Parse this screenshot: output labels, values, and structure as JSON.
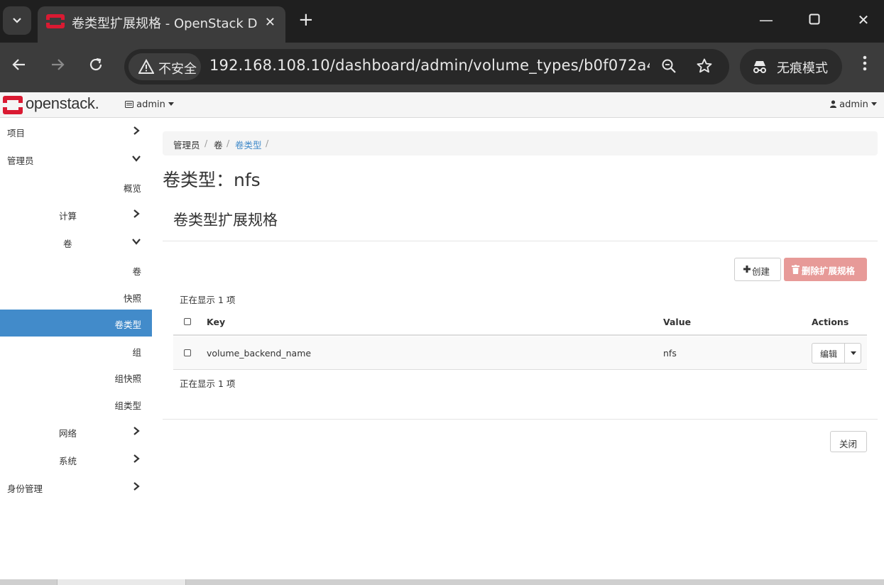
{
  "browser": {
    "tab_title": "卷类型扩展规格 - OpenStack D",
    "security_label": "不安全",
    "url": "192.168.108.10/dashboard/admin/volume_types/b0f072a4-...",
    "incognito_label": "无痕模式"
  },
  "navbar": {
    "logo_text": "openstack.",
    "project_label": "admin",
    "user_label": "admin"
  },
  "sidebar": {
    "items": [
      {
        "label": "项目"
      },
      {
        "label": "管理员"
      },
      {
        "label": "概览"
      },
      {
        "label": "计算"
      },
      {
        "label": "卷"
      },
      {
        "label": "卷"
      },
      {
        "label": "快照"
      },
      {
        "label": "卷类型"
      },
      {
        "label": "组"
      },
      {
        "label": "组快照"
      },
      {
        "label": "组类型"
      },
      {
        "label": "网络"
      },
      {
        "label": "系统"
      },
      {
        "label": "身份管理"
      }
    ]
  },
  "breadcrumb": {
    "items": [
      "管理员",
      "卷",
      "卷类型"
    ],
    "separator": "/"
  },
  "page": {
    "title": "卷类型：nfs",
    "section_title": "卷类型扩展规格",
    "create_label": "创建",
    "delete_label": "删除扩展规格",
    "count_top": "正在显示 1 项",
    "count_bottom": "正在显示 1 项",
    "close_label": "关闭"
  },
  "table": {
    "headers": {
      "key": "Key",
      "value": "Value",
      "actions": "Actions"
    },
    "rows": [
      {
        "key": "volume_backend_name",
        "value": "nfs",
        "action": "编辑"
      }
    ]
  },
  "colors": {
    "accent": "#428bca",
    "danger_disabled": "#e79a98",
    "openstack_red": "#da1a32"
  }
}
